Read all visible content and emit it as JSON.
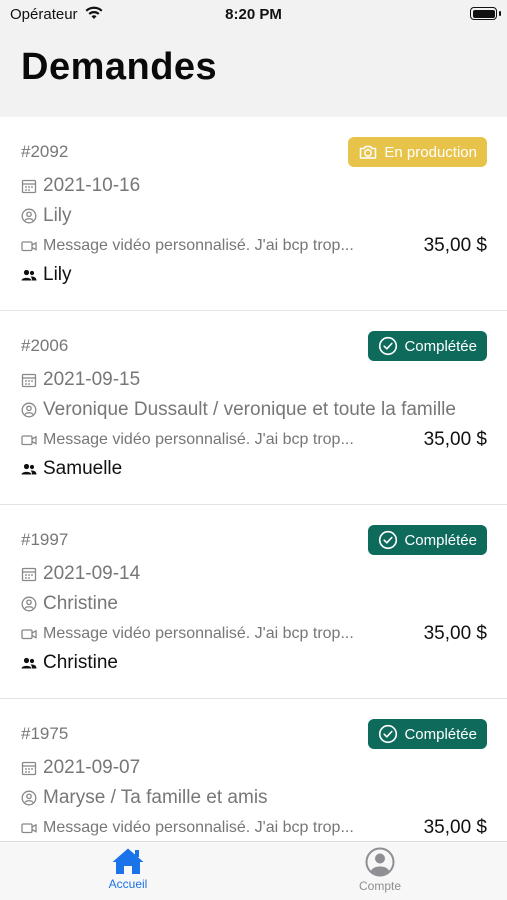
{
  "status_bar": {
    "carrier": "Opérateur",
    "time": "8:20 PM"
  },
  "header": {
    "title": "Demandes"
  },
  "requests": [
    {
      "id": "#2092",
      "status": "En production",
      "status_kind": "production",
      "date": "2021-10-16",
      "client": "Lily",
      "message": "Message vidéo personnalisé. J'ai bcp trop...",
      "price": "35,00 $",
      "recipient": "Lily"
    },
    {
      "id": "#2006",
      "status": "Complétée",
      "status_kind": "completed",
      "date": "2021-09-15",
      "client": "Veronique Dussault / veronique et toute la famille",
      "message": "Message vidéo personnalisé. J'ai bcp trop...",
      "price": "35,00 $",
      "recipient": "Samuelle"
    },
    {
      "id": "#1997",
      "status": "Complétée",
      "status_kind": "completed",
      "date": "2021-09-14",
      "client": "Christine",
      "message": "Message vidéo personnalisé. J'ai bcp trop...",
      "price": "35,00 $",
      "recipient": "Christine"
    },
    {
      "id": "#1975",
      "status": "Complétée",
      "status_kind": "completed",
      "date": "2021-09-07",
      "client": "Maryse / Ta famille et amis",
      "message": "Message vidéo personnalisé. J'ai bcp trop...",
      "price": "35,00 $",
      "recipient": ""
    }
  ],
  "tabbar": {
    "home_label": "Accueil",
    "account_label": "Compte"
  },
  "colors": {
    "accent": "#1a73e8",
    "in_production": "#e8c34a",
    "completed": "#0e6b5c"
  },
  "icons": [
    "wifi-icon",
    "battery-icon",
    "camera-icon",
    "check-circle-icon",
    "calendar-icon",
    "user-circle-icon",
    "video-icon",
    "group-icon",
    "home-icon",
    "account-icon"
  ]
}
